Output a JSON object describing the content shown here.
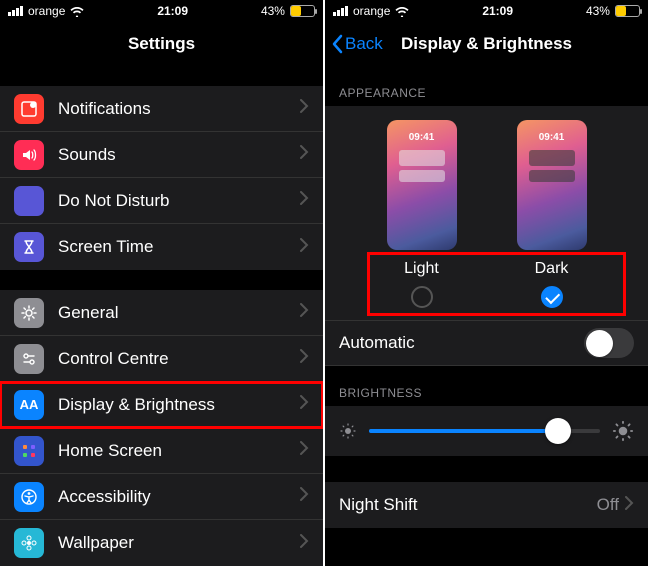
{
  "status": {
    "carrier": "orange",
    "time": "21:09",
    "battery_pct": "43%",
    "battery_fill": 43
  },
  "left": {
    "title": "Settings",
    "group1": [
      {
        "label": "Notifications",
        "bg": "#ff3b30",
        "glyph": "notif"
      },
      {
        "label": "Sounds",
        "bg": "#ff2d55",
        "glyph": "sounds"
      },
      {
        "label": "Do Not Disturb",
        "bg": "#5856d6",
        "glyph": "moon"
      },
      {
        "label": "Screen Time",
        "bg": "#5856d6",
        "glyph": "hourglass"
      }
    ],
    "group2": [
      {
        "label": "General",
        "bg": "#8e8e93",
        "glyph": "gear"
      },
      {
        "label": "Control Centre",
        "bg": "#8e8e93",
        "glyph": "sliders"
      },
      {
        "label": "Display & Brightness",
        "bg": "#0a84ff",
        "glyph": "AA",
        "highlight": true
      },
      {
        "label": "Home Screen",
        "bg": "#3355cc",
        "glyph": "grid"
      },
      {
        "label": "Accessibility",
        "bg": "#0a84ff",
        "glyph": "person"
      },
      {
        "label": "Wallpaper",
        "bg": "#26b8d6",
        "glyph": "flower"
      }
    ]
  },
  "right": {
    "back": "Back",
    "title": "Display & Brightness",
    "appearance_header": "APPEARANCE",
    "mock_time": "09:41",
    "light_label": "Light",
    "dark_label": "Dark",
    "automatic_label": "Automatic",
    "automatic_on": false,
    "brightness_header": "BRIGHTNESS",
    "brightness_pct": 82,
    "night_shift_label": "Night Shift",
    "night_shift_value": "Off"
  }
}
